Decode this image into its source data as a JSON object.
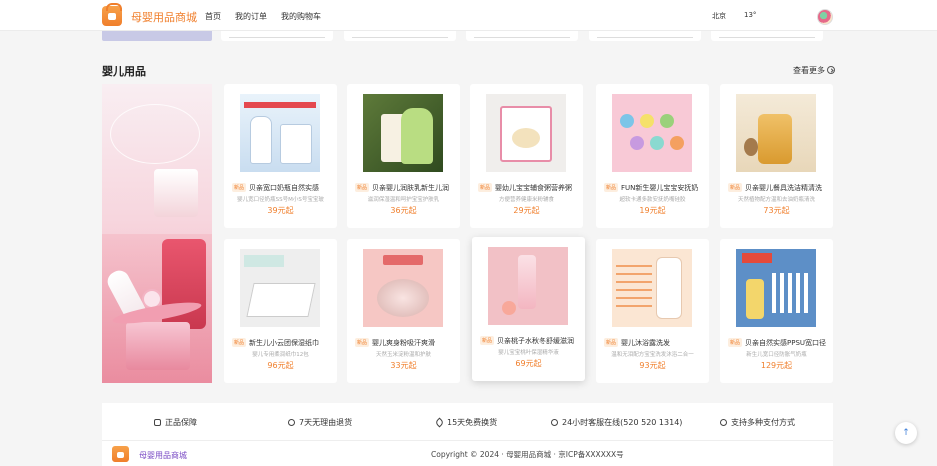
{
  "header": {
    "site_name": "母婴用品商城",
    "nav": [
      "首页",
      "我的订单",
      "我的购物车"
    ],
    "city": "北京",
    "temperature": "13°"
  },
  "section": {
    "title": "婴儿用品",
    "more": "查看更多"
  },
  "products": [
    {
      "tag": "新品",
      "title": "贝亲宽口奶瓶自然实感",
      "desc": "婴儿宽口径奶瓶SS号M小S号宝宝玻",
      "price": "39元起"
    },
    {
      "tag": "新品",
      "title": "贝亲婴儿润肤乳新生儿润",
      "desc": "滋润保湿温和呵护宝宝护肤乳",
      "price": "36元起"
    },
    {
      "tag": "新品",
      "title": "婴幼儿宝宝辅食粥营养粥",
      "desc": "方便营养健康米粉辅食",
      "price": "29元起"
    },
    {
      "tag": "新品",
      "title": "FUN新生婴儿宝宝安抚奶",
      "desc": "超软卡通多款安抚奶嘴硅胶",
      "price": "19元起"
    },
    {
      "tag": "新品",
      "title": "贝亲婴儿餐具洗洁精清洗",
      "desc": "天然植物配方温和去油奶瓶清洗",
      "price": "73元起"
    },
    {
      "tag": "新品",
      "title": "新生儿小云团保湿纸巾",
      "desc": "婴儿专用柔润纸巾12包",
      "price": "96元起"
    },
    {
      "tag": "新品",
      "title": "婴儿爽身粉吸汗爽滑",
      "desc": "天然玉米淀粉温和护肤",
      "price": "33元起"
    },
    {
      "tag": "新品",
      "title": "贝亲桃子水秋冬舒缓滋润",
      "desc": "婴儿宝宝桃叶保湿精华液",
      "price": "69元起"
    },
    {
      "tag": "新品",
      "title": "婴儿沐浴露洗发",
      "desc": "温和无泪配方宝宝洗发沐浴二合一",
      "price": "93元起"
    },
    {
      "tag": "新品",
      "title": "贝亲自然实感PPSU宽口径",
      "desc": "新生儿宽口径防胀气奶瓶",
      "price": "129元起"
    }
  ],
  "features": [
    "正品保障",
    "7天无理由退货",
    "15天免费换货",
    "24小时客服在线(520 520 1314)",
    "支持多种支付方式"
  ],
  "footer": {
    "name": "母婴用品商城",
    "copyright": "Copyright © 2024 · 母婴用品商城 · 京ICP备XXXXXX号"
  },
  "colors": {
    "brand": "#f07f2c",
    "footer_name": "#7a4bc4"
  }
}
